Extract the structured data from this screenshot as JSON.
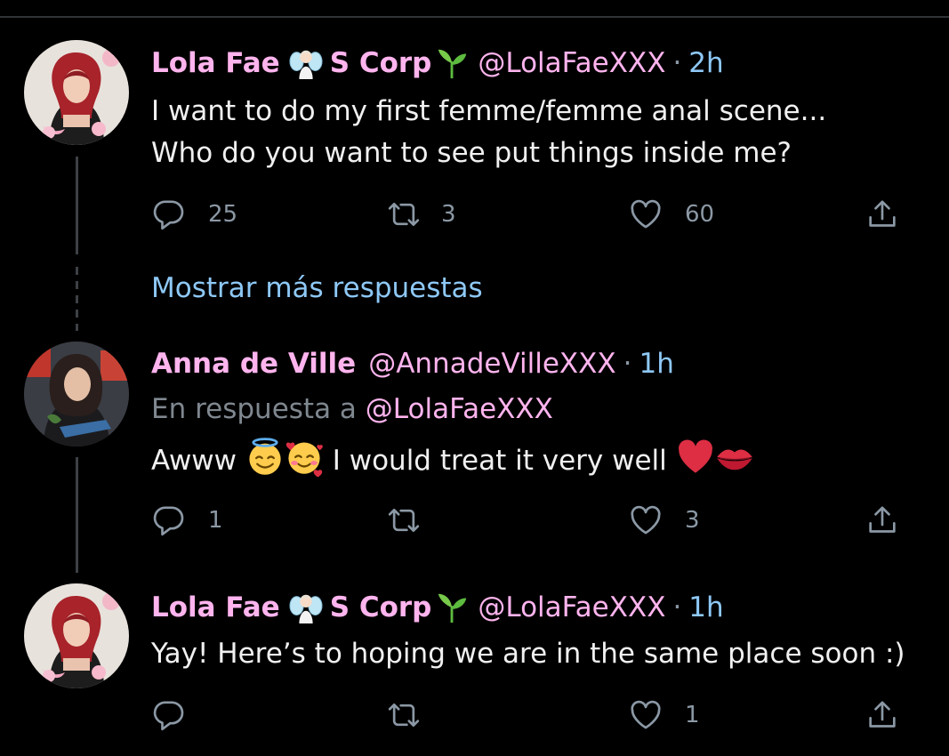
{
  "tweets": [
    {
      "author_name": "Lola Fae",
      "author_emoji": "fairy-emoji",
      "author_suffix": "S Corp",
      "author_suffix_emoji": "seedling-emoji",
      "handle": "@LolaFaeXXX",
      "separator": "·",
      "time": "2h",
      "text_lines": [
        "I want to do my first femme/femme anal scene...",
        "Who do you want to see put things inside me?"
      ],
      "replies": "25",
      "retweets": "3",
      "likes": "60"
    },
    {
      "author_name": "Anna de Ville",
      "handle": "@AnnadeVilleXXX",
      "separator": "·",
      "time": "1h",
      "reply_prefix": "En respuesta a",
      "reply_to": "@LolaFaeXXX",
      "text_parts": [
        "Awww",
        "I would treat it very well"
      ],
      "text_emojis": [
        "smiling-face-with-halo-emoji",
        "smiling-face-with-hearts-emoji",
        "red-heart-emoji",
        "kiss-mark-emoji"
      ],
      "replies": "1",
      "retweets": "",
      "likes": "3"
    },
    {
      "author_name": "Lola Fae",
      "author_emoji": "fairy-emoji",
      "author_suffix": "S Corp",
      "author_suffix_emoji": "seedling-emoji",
      "handle": "@LolaFaeXXX",
      "separator": "·",
      "time": "1h",
      "text_lines": [
        "Yay! Here’s to hoping we are in the same place soon :)"
      ],
      "replies": "",
      "retweets": "",
      "likes": "1"
    }
  ],
  "show_more_label": "Mostrar más respuestas",
  "icons": [
    "reply-icon",
    "retweet-icon",
    "like-icon",
    "share-icon"
  ],
  "colors": {
    "background": "#000000",
    "name": "#ffb4ee",
    "link": "#8ec8f6",
    "muted": "#8b98a5",
    "text": "#f0f0f0"
  }
}
